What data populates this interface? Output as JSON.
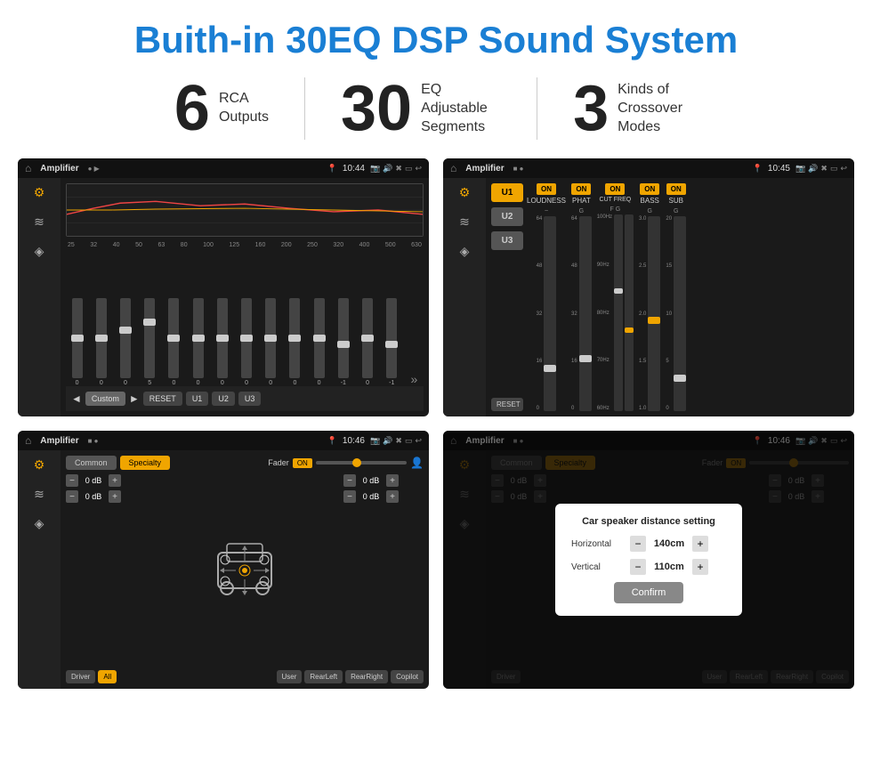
{
  "header": {
    "title": "Buith-in 30EQ DSP Sound System"
  },
  "stats": [
    {
      "number": "6",
      "text_line1": "RCA",
      "text_line2": "Outputs"
    },
    {
      "number": "30",
      "text_line1": "EQ Adjustable",
      "text_line2": "Segments"
    },
    {
      "number": "3",
      "text_line1": "Kinds of",
      "text_line2": "Crossover Modes"
    }
  ],
  "screen1": {
    "app_title": "Amplifier",
    "time": "10:44",
    "eq_labels": [
      "25",
      "32",
      "40",
      "50",
      "63",
      "80",
      "100",
      "125",
      "160",
      "200",
      "250",
      "320",
      "400",
      "500",
      "630"
    ],
    "eq_values": [
      "0",
      "0",
      "0",
      "5",
      "0",
      "0",
      "0",
      "0",
      "0",
      "0",
      "0",
      "-1",
      "0",
      "-1"
    ],
    "bottom_btns": [
      "Custom",
      "RESET",
      "U1",
      "U2",
      "U3"
    ]
  },
  "screen2": {
    "app_title": "Amplifier",
    "time": "10:45",
    "channels": [
      "LOUDNESS",
      "PHAT",
      "CUT FREQ",
      "BASS",
      "SUB"
    ],
    "u_buttons": [
      "U1",
      "U2",
      "U3"
    ],
    "reset_label": "RESET"
  },
  "screen3": {
    "app_title": "Amplifier",
    "time": "10:46",
    "tabs": [
      "Common",
      "Specialty"
    ],
    "fader_label": "Fader",
    "on_label": "ON",
    "db_values": [
      "0 dB",
      "0 dB",
      "0 dB",
      "0 dB"
    ],
    "bottom_labels": [
      "Driver",
      "All",
      "User",
      "RearLeft",
      "RearRight",
      "Copilot"
    ]
  },
  "screen4": {
    "app_title": "Amplifier",
    "time": "10:46",
    "tabs": [
      "Common",
      "Specialty"
    ],
    "dialog": {
      "title": "Car speaker distance setting",
      "horizontal_label": "Horizontal",
      "horizontal_value": "140cm",
      "vertical_label": "Vertical",
      "vertical_value": "110cm",
      "confirm_label": "Confirm",
      "db_labels": [
        "0 dB",
        "0 dB"
      ],
      "bottom_labels": [
        "Driver",
        "User",
        "RearLeft",
        "RearRight",
        "Copilot"
      ]
    }
  }
}
